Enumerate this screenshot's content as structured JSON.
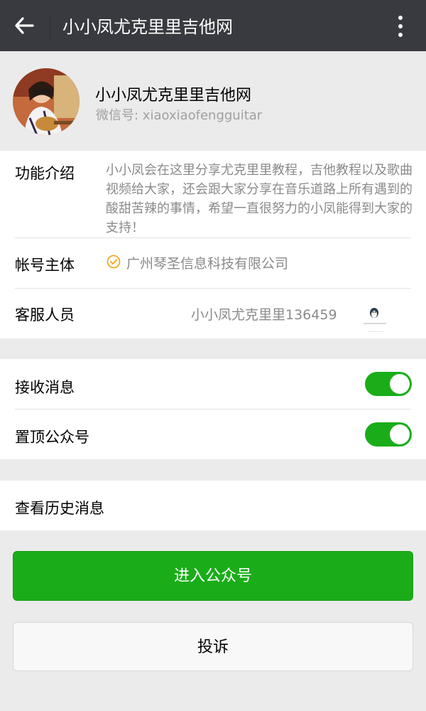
{
  "topbar": {
    "title": "小小凤尤克里里吉他网",
    "back_icon": "arrow-left-icon",
    "more_icon": "more-vertical-icon"
  },
  "profile": {
    "name": "小小凤尤克里里吉他网",
    "wechat_label": "微信号: ",
    "wechat_id": "xiaoxiaofengguitar"
  },
  "info": {
    "intro_label": "功能介绍",
    "intro_text": "小小凤会在这里分享尤克里里教程，吉他教程以及歌曲视频给大家，还会跟大家分享在音乐道路上所有遇到的酸甜苦辣的事情，希望一直很努力的小凤能得到大家的支持！",
    "subject_label": "帐号主体",
    "subject_text": "广州琴圣信息科技有限公司",
    "cs_label": "客服人员",
    "cs_text": "小小凤尤克里里136459"
  },
  "settings": {
    "receive_label": "接收消息",
    "receive_on": true,
    "pin_label": "置顶公众号",
    "pin_on": true
  },
  "history": {
    "label": "查看历史消息"
  },
  "buttons": {
    "enter": "进入公众号",
    "report": "投诉"
  },
  "colors": {
    "topbar": "#393a3f",
    "accent_green": "#1aad19",
    "verify_orange": "#f5a623",
    "background": "#ebebeb"
  }
}
